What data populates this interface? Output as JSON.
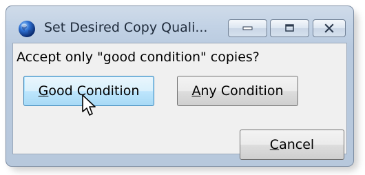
{
  "window": {
    "title": "Set Desired Copy Quali...",
    "icon": "globe-icon",
    "controls": [
      "minimize-icon",
      "restore-icon",
      "close-icon"
    ]
  },
  "dialog": {
    "prompt": "Accept only \"good condition\" copies?",
    "buttons": {
      "good": {
        "label_prefix": "",
        "mnemonic": "G",
        "label_rest": "ood Condition"
      },
      "any": {
        "label_prefix": "",
        "mnemonic": "A",
        "label_rest": "ny Condition"
      },
      "cancel": {
        "label_prefix": "",
        "mnemonic": "C",
        "label_rest": "ancel"
      }
    }
  },
  "colors": {
    "titlebar": "#c2d2e5",
    "client": "#f0f0f0",
    "default_button": "#bee6fd"
  }
}
